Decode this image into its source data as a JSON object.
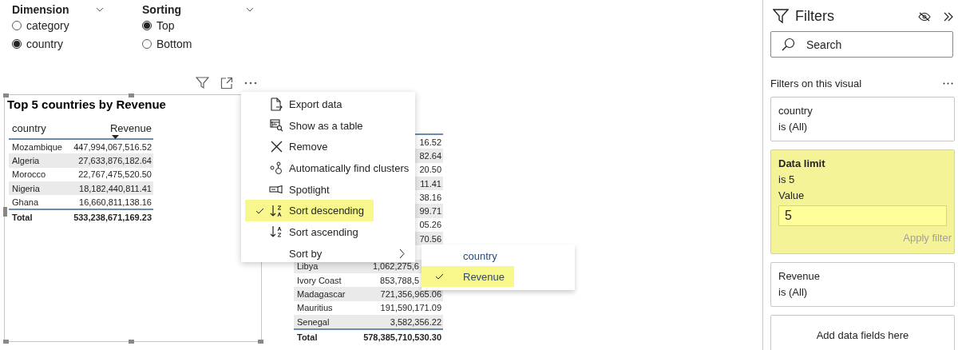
{
  "slicers": [
    {
      "title": "Dimension",
      "options": [
        {
          "label": "category",
          "selected": false
        },
        {
          "label": "country",
          "selected": true
        }
      ]
    },
    {
      "title": "Sorting",
      "options": [
        {
          "label": "Top",
          "selected": true
        },
        {
          "label": "Bottom",
          "selected": false
        }
      ]
    }
  ],
  "visuals": [
    {
      "title": "Top 5 countries by Revenue",
      "selected": true,
      "columns": [
        {
          "label": "country",
          "sorted": false
        },
        {
          "label": "Revenue",
          "sorted": true
        }
      ],
      "rows": [
        {
          "kind": "full",
          "cells": [
            "Mozambique",
            "447,994,067,516.52"
          ]
        },
        {
          "kind": "full",
          "cells": [
            "Algeria",
            "27,633,876,182.64"
          ]
        },
        {
          "kind": "full",
          "cells": [
            "Morocco",
            "22,767,475,520.50"
          ]
        },
        {
          "kind": "full",
          "cells": [
            "Nigeria",
            "18,182,440,811.41"
          ]
        },
        {
          "kind": "full",
          "cells": [
            "Ghana",
            "16,660,811,138.16"
          ]
        }
      ],
      "total": [
        "Total",
        "533,238,671,169.23"
      ]
    },
    {
      "selected": false,
      "rows": [
        {
          "kind": "tail",
          "cells": [
            "16.52"
          ]
        },
        {
          "kind": "tail",
          "cells": [
            "82.64"
          ]
        },
        {
          "kind": "tail",
          "cells": [
            "20.50"
          ]
        },
        {
          "kind": "tail",
          "cells": [
            "11.41"
          ]
        },
        {
          "kind": "tail",
          "cells": [
            "38.16"
          ]
        },
        {
          "kind": "tail",
          "cells": [
            "99.71"
          ]
        },
        {
          "kind": "tail",
          "cells": [
            "05.26"
          ]
        },
        {
          "kind": "tail",
          "cells": [
            "70.56"
          ]
        },
        {
          "kind": "covered"
        },
        {
          "kind": "head",
          "cells": [
            "Libya",
            "1,062,275,6"
          ]
        },
        {
          "kind": "head",
          "cells": [
            "Ivory Coast",
            "853,788,5"
          ]
        },
        {
          "kind": "full",
          "cells": [
            "Madagascar",
            "721,356,965.06"
          ]
        },
        {
          "kind": "full",
          "cells": [
            "Mauritius",
            "191,590,171.09"
          ]
        },
        {
          "kind": "full",
          "cells": [
            "Senegal",
            "3,582,356.22"
          ]
        }
      ],
      "total": [
        "Total",
        "578,385,710,530.30"
      ]
    }
  ],
  "context_menu": {
    "items": [
      {
        "kind": "export",
        "label": "Export data",
        "checked": false,
        "highlighted": false
      },
      {
        "kind": "table",
        "label": "Show as a table",
        "checked": false,
        "highlighted": false
      },
      {
        "kind": "remove",
        "label": "Remove",
        "checked": false,
        "highlighted": false
      },
      {
        "kind": "clusters",
        "label": "Automatically find clusters",
        "checked": false,
        "highlighted": false
      },
      {
        "kind": "spotlight",
        "label": "Spotlight",
        "checked": false,
        "highlighted": false
      },
      {
        "kind": "sort-desc",
        "label": "Sort descending",
        "checked": true,
        "highlighted": true
      },
      {
        "kind": "sort-asc",
        "label": "Sort ascending",
        "checked": false,
        "highlighted": false
      },
      {
        "kind": "submenu",
        "label": "Sort by",
        "checked": false,
        "highlighted": false
      }
    ],
    "submenu": [
      {
        "label": "country",
        "checked": false,
        "highlighted": false
      },
      {
        "label": "Revenue",
        "checked": true,
        "highlighted": true
      }
    ]
  },
  "filters_pane": {
    "title": "Filters",
    "search": {
      "placeholder": "Search"
    },
    "section": "Filters on this visual",
    "cards": [
      {
        "kind": "filter",
        "field": "country",
        "summary": "is (All)",
        "highlighted": false
      },
      {
        "kind": "limit",
        "field": "Data limit",
        "summary": "is 5",
        "value_label": "Value",
        "value": "5",
        "action": "Apply filter",
        "action_disabled": true,
        "highlighted": true
      },
      {
        "kind": "filter",
        "field": "Revenue",
        "summary": "is (All)",
        "highlighted": false
      },
      {
        "kind": "drop",
        "label": "Add data fields here",
        "highlighted": false
      }
    ]
  }
}
